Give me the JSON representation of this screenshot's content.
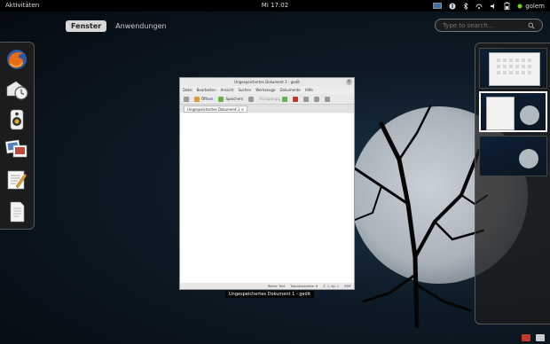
{
  "top_panel": {
    "activities": "Aktivitäten",
    "clock": "Mi 17:02",
    "user": "golem"
  },
  "overview": {
    "tabs": [
      {
        "label": "Fenster",
        "active": true
      },
      {
        "label": "Anwendungen",
        "active": false
      }
    ],
    "search_placeholder": "Type to search..."
  },
  "dash": {
    "items": [
      {
        "name": "Firefox",
        "icon": "firefox-icon"
      },
      {
        "name": "Evolution",
        "icon": "mail-clock-icon"
      },
      {
        "name": "Rhythmbox",
        "icon": "speaker-icon"
      },
      {
        "name": "Shotwell",
        "icon": "photos-icon"
      },
      {
        "name": "gedit",
        "icon": "text-editor-icon"
      },
      {
        "name": "LibreOffice Writer",
        "icon": "document-icon"
      }
    ]
  },
  "window": {
    "title": "Ungespeichertes Dokument 1 - gedit",
    "menu": [
      "Datei",
      "Bearbeiten",
      "Ansicht",
      "Suchen",
      "Werkzeuge",
      "Dokumente",
      "Hilfe"
    ],
    "toolbar": {
      "open": "Öffnen",
      "save": "Speichern",
      "undo": "Rückgängig"
    },
    "doc_tab": "Ungespeichertes Dokument 1",
    "status": {
      "mode": "Reiner Text",
      "tab_width": "Tabulatorbreite: 8",
      "position": "Z. 1, Sp. 1",
      "insert": "EINF"
    },
    "caption": "Ungespeichertes Dokument 1 - gedit"
  },
  "colors": {
    "panel": "#000000",
    "accent_active_tab": "#d8d8d8",
    "workspace_border_active": "#ffffff"
  }
}
